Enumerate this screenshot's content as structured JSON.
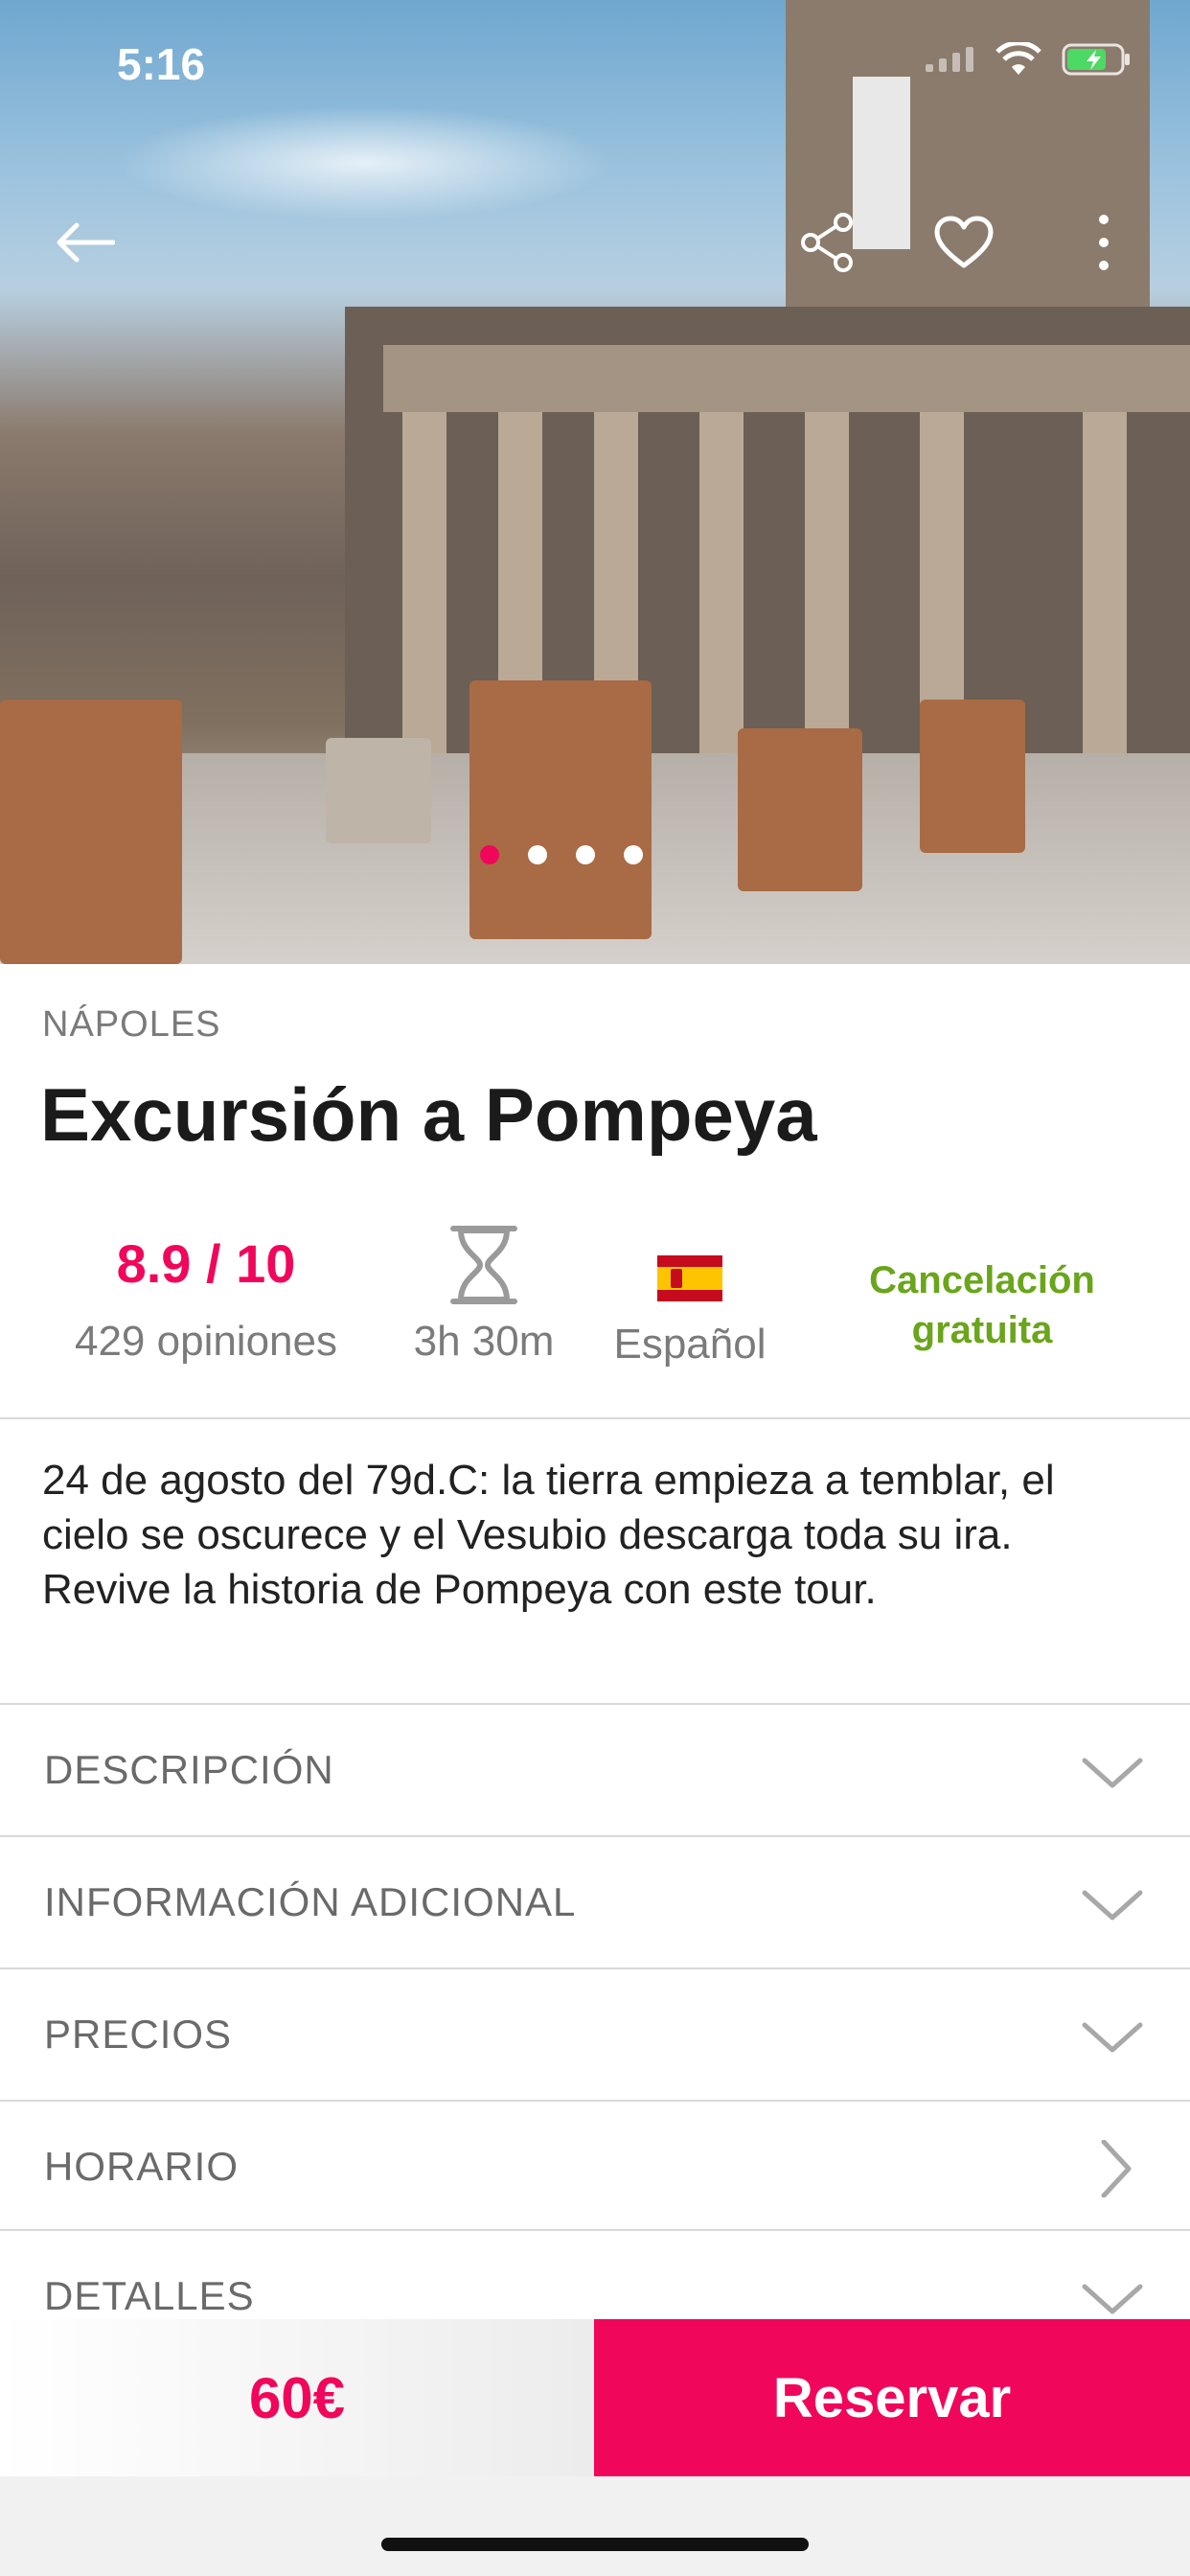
{
  "status_bar": {
    "time": "5:16"
  },
  "hero": {
    "slide_count": 4,
    "active_slide": 1
  },
  "nav": {
    "back_icon": "arrow-left-icon",
    "share_icon": "share-icon",
    "favorite_icon": "heart-icon",
    "more_icon": "more-vertical-icon"
  },
  "tour": {
    "city": "NÁPOLES",
    "title": "Excursión a Pompeya",
    "rating": "8.9 / 10",
    "reviews": "429 opiniones",
    "duration": "3h 30m",
    "language": "Español",
    "cancellation": "Cancelación gratuita",
    "description": "24 de agosto del 79d.C: la tierra empieza a temblar, el cielo se oscurece y el Vesubio descarga toda su ira. Revive la historia de Pompeya con este tour."
  },
  "sections": [
    {
      "label": "DESCRIPCIÓN",
      "icon": "chevron-down-icon"
    },
    {
      "label": "INFORMACIÓN ADICIONAL",
      "icon": "chevron-down-icon"
    },
    {
      "label": "PRECIOS",
      "icon": "chevron-down-icon"
    },
    {
      "label": "HORARIO",
      "icon": "chevron-right-icon"
    },
    {
      "label": "DETALLES",
      "icon": "chevron-down-icon"
    }
  ],
  "booking": {
    "price": "60€",
    "button_label": "Reservar"
  },
  "colors": {
    "accent": "#f0075b",
    "success": "#6aa51b"
  }
}
